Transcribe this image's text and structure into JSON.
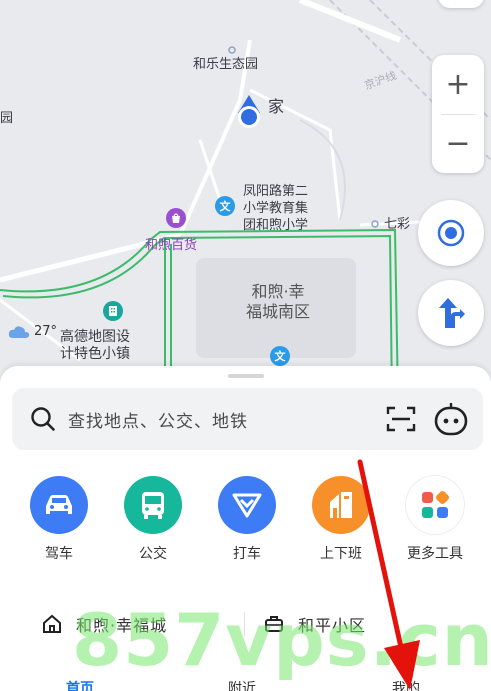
{
  "map": {
    "labels": {
      "park": "和乐生态园",
      "home": "家",
      "school": "凤阳路第二\n小学教育集\n团和煦小学",
      "store": "和煦百货",
      "district": "和煦·幸\n福城南区",
      "town": "高德地图设\n计特色小镇",
      "qicai": "七彩",
      "road": "京沪线",
      "left_cut": "园"
    },
    "weather": {
      "temp": "27°"
    },
    "controls": {
      "zoom_in": "+",
      "zoom_out": "−"
    },
    "icons": {
      "location": "current-location-icon",
      "locate": "locate-icon",
      "direction": "direction-arrow-icon"
    }
  },
  "sheet": {
    "search": {
      "placeholder": "查找地点、公交、地铁",
      "scan_icon": "scan-icon",
      "assistant_icon": "assistant-robot-icon"
    },
    "quick_actions": [
      {
        "label": "驾车",
        "icon": "car-icon",
        "color": "#3d7cf4"
      },
      {
        "label": "公交",
        "icon": "bus-icon",
        "color": "#16b79a"
      },
      {
        "label": "打车",
        "icon": "taxi-icon",
        "color": "#3d7cf4"
      },
      {
        "label": "上下班",
        "icon": "commute-icon",
        "color": "#f7902a"
      },
      {
        "label": "更多工具",
        "icon": "grid-icon",
        "color": "#ffffff"
      }
    ],
    "places": [
      {
        "label": "和煦·幸福城",
        "icon": "home-icon"
      },
      {
        "label": "和平小区",
        "icon": "briefcase-icon"
      }
    ],
    "tabs": [
      {
        "label": "首页",
        "active": true
      },
      {
        "label": "附近",
        "active": false
      },
      {
        "label": "我的",
        "active": false
      }
    ]
  },
  "watermark": "857vps.cn",
  "colors": {
    "accent": "#1a73e8",
    "green_boundary": "#3cbc6a",
    "arrow": "#e3120b"
  }
}
